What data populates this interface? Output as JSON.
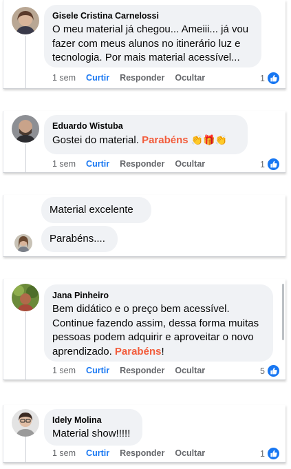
{
  "comments": [
    {
      "author": "Gisele Cristina Carnelossi",
      "text": "O meu material já chegou... Ameiii... já vou fazer com meus alunos no itinerário luz e tecnologia. Por mais material acessível...",
      "time": "1 sem",
      "reactions": "1"
    },
    {
      "author": "Eduardo Wistuba",
      "text_pre": "Gostei do material. ",
      "highlight": "Parabéns",
      "emojis": "👏🎁👏",
      "time": "1 sem",
      "reactions": "1"
    },
    {
      "messages": [
        "Material excelente",
        "Parabéns...."
      ]
    },
    {
      "author": "Jana Pinheiro",
      "text_pre": "Bem didático e o preço bem acessível. Continue fazendo assim, dessa forma muitas pessoas podem adquirir e aproveitar o novo aprendizado. ",
      "highlight": "Parabéns",
      "text_post": "!",
      "time": "1 sem",
      "reactions": "5"
    },
    {
      "author": "Idely Molina",
      "text": "Material show!!!!!",
      "time": "1 sem",
      "reactions": "1"
    }
  ],
  "labels": {
    "like": "Curtir",
    "reply": "Responder",
    "hide": "Ocultar"
  },
  "colors": {
    "like_blue": "#1877f2",
    "highlight": "#f25c3b",
    "bubble": "#f0f2f5"
  }
}
